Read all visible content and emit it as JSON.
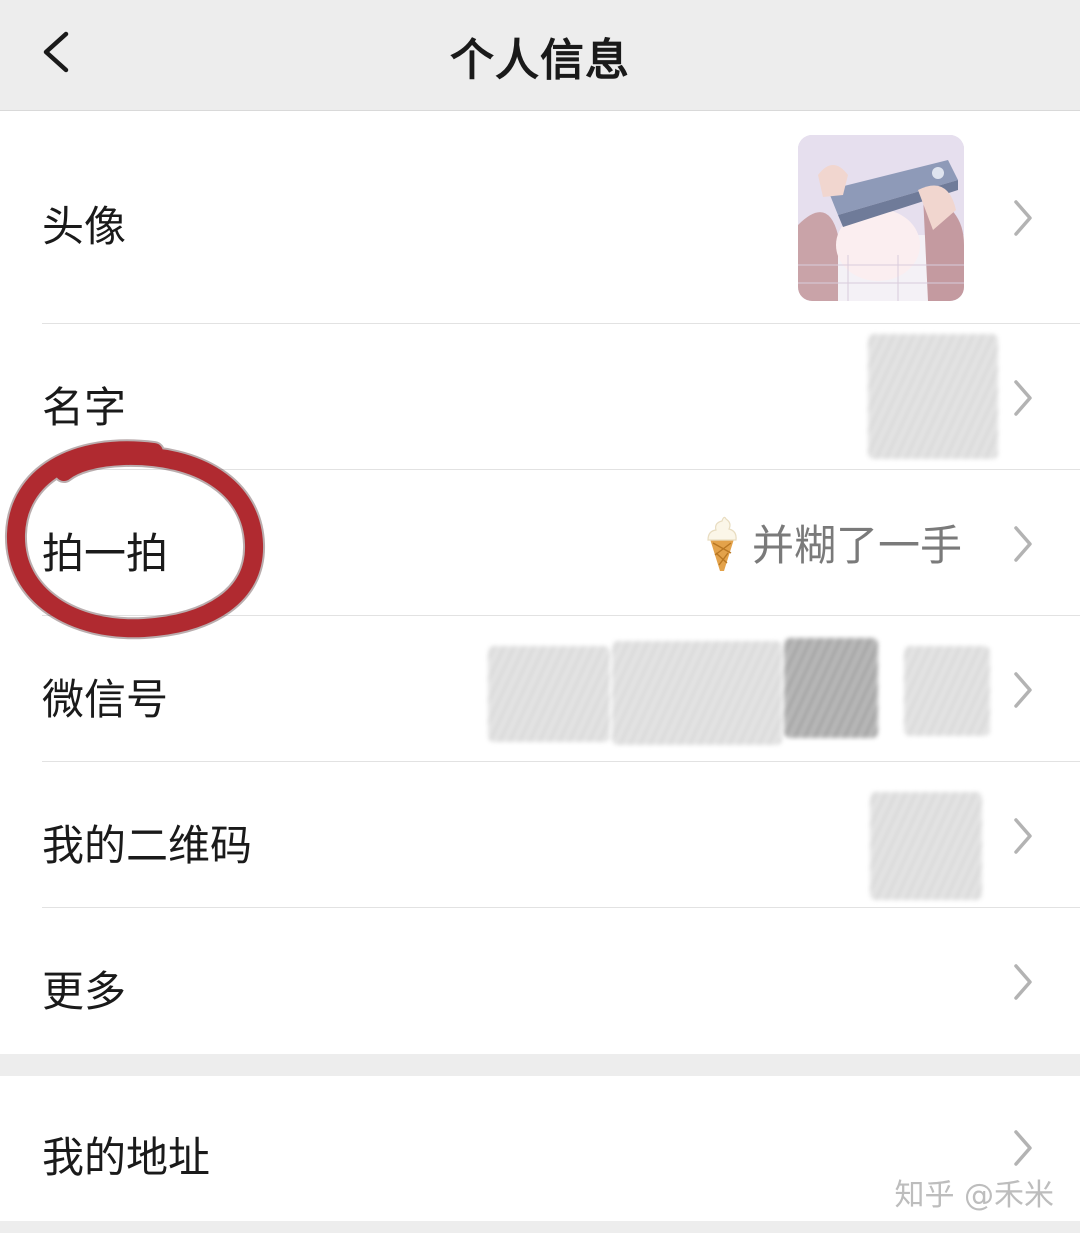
{
  "header": {
    "title": "个人信息",
    "back_icon": "chevron-left-icon"
  },
  "rows": [
    {
      "key": "avatar",
      "label": "头像"
    },
    {
      "key": "name",
      "label": "名字"
    },
    {
      "key": "pat",
      "label": "拍一拍",
      "value": "并糊了一手",
      "value_emoji": "soft-serve-ice-cream-icon"
    },
    {
      "key": "wechat_id",
      "label": "微信号"
    },
    {
      "key": "qr_code",
      "label": "我的二维码"
    },
    {
      "key": "more",
      "label": "更多"
    }
  ],
  "address_row": {
    "label": "我的地址"
  },
  "watermark": "知乎 @禾米",
  "colors": {
    "background": "#ededed",
    "row_background": "#ffffff",
    "annotation_circle": "#b02a30",
    "secondary_text": "#7a7a7a"
  }
}
